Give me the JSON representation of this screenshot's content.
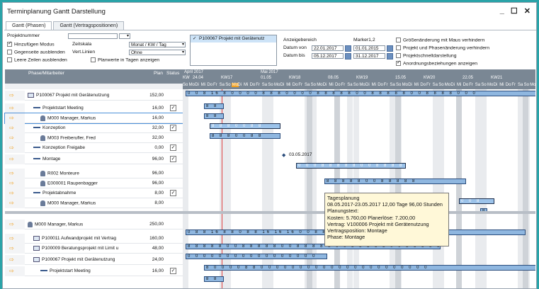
{
  "window": {
    "title": "Terminplanung Gantt Darstellung",
    "minimize": "_",
    "maximize": "☐",
    "close": "✕"
  },
  "tabs": [
    "Gantt (Phasen)",
    "Gantt (Vertragspositionen)"
  ],
  "params": {
    "projektnummer_label": "Projektnummer",
    "hinzufuegen_label": "Hinzufügen Modus",
    "gegenseite_label": "Gegenseite ausblenden",
    "leere_label": "Leere Zeilen ausblenden",
    "zeitskala_label": "Zeitskala",
    "zeitskala_value": "Monat / KW / Tag",
    "vertlinien_label": "Vert.Linien",
    "vertlinien_value": "Ohne",
    "planwerte_label": "Planwerte in Tagen  anzeigen",
    "anzeigebereich_label": "Anzeigebereich",
    "datum_von_label": "Datum von",
    "datum_von": "22.01.2017",
    "datum_bis_label": "Datum bis",
    "datum_bis": "05.12.2017",
    "marker_label": "Marker1,2",
    "marker1": "01.01.2015",
    "marker2": "31.12.2017",
    "opt1": "Größenänderung mit Maus verhindern",
    "opt2": "Projekt und Phasenänderung verhindern",
    "opt3": "Projektschnelldarstellung",
    "opt4": "Anordnungsbeziehungen anzeigen",
    "project_item": "P100067 Projekt mit Gerätenutz"
  },
  "table_header": {
    "phase": "Phase/Mitarbeiter",
    "plan": "Plan",
    "status": "Status"
  },
  "gantt_header": {
    "month1": "April 2017",
    "month2": "Mai 2017",
    "kw": [
      "KW",
      "24.04",
      "KW17",
      "01.05",
      "KW18",
      "08.05",
      "KW19",
      "15.05",
      "KW20",
      "22.05",
      "KW21"
    ],
    "days": [
      "So",
      "Mo",
      "Di",
      "Mi",
      "Do",
      "Fr",
      "Sa",
      "So",
      "Mo",
      "Di",
      "Mi",
      "Do",
      "Fr",
      "Sa",
      "So",
      "Mo",
      "Di",
      "Mi",
      "Do",
      "Fr",
      "Sa",
      "So",
      "Mo",
      "Di",
      "Mi",
      "Do",
      "Fr",
      "Sa",
      "So",
      "Mo",
      "Di",
      "Mi",
      "Do",
      "Fr",
      "Sa",
      "So",
      "Mo",
      "Di",
      "Mi",
      "Do",
      "Fr",
      "Sa",
      "So",
      "Mo",
      "Di",
      "Mi",
      "Do",
      "Fr",
      "Sa",
      "So",
      "Mo",
      "Di",
      "Mi",
      "Do",
      "Fr",
      "Sa",
      "So",
      "Mo"
    ]
  },
  "rows": [
    {
      "name": "P100067  Projekt mit Gerätenutzung",
      "plan": "152,00",
      "status": ""
    },
    {
      "name": "Projektstart Meeting",
      "plan": "16,00",
      "status": "✓"
    },
    {
      "name": "M000 Manager, Markus",
      "plan": "16,00",
      "status": ""
    },
    {
      "name": "Konzeption",
      "plan": "32,00",
      "status": "✓"
    },
    {
      "name": "M003 Freiberufler, Fred",
      "plan": "32,00",
      "status": ""
    },
    {
      "name": "Konzeption Freigabe",
      "plan": "0,00",
      "status": "✓"
    },
    {
      "name": "Montage",
      "plan": "96,00",
      "status": "✓"
    },
    {
      "name": "R002 Monteure",
      "plan": "96,00",
      "status": ""
    },
    {
      "name": "E000001 Raupenbagger",
      "plan": "96,00",
      "status": ""
    },
    {
      "name": "Projektabnahme",
      "plan": "8,00",
      "status": "✓"
    },
    {
      "name": "M000 Manager, Markus",
      "plan": "8,00",
      "status": ""
    },
    {
      "name": "M000 Manager, Markus",
      "plan": "250,00",
      "status": ""
    },
    {
      "name": "P100011  Aufwandprojekt mit Vertrag",
      "plan": "160,00",
      "status": ""
    },
    {
      "name": "P100009  Beratungsprojekt mit Limit u",
      "plan": "48,00",
      "status": ""
    },
    {
      "name": "P100067  Projekt mit Gerätenutzung",
      "plan": "24,00",
      "status": ""
    },
    {
      "name": "Projektstart Meeting",
      "plan": "16,00",
      "status": "✓"
    }
  ],
  "milestone_label": "03.05.2017",
  "tooltip": {
    "line1": "Tagesplanung",
    "line2": "08.05.2017-23.05.2017 12,00 Tage 96,00 Stunden",
    "line3": "Planungstext:",
    "line4": "Kosten: 5.760,00 Planerlöse: 7.200,00",
    "line5": "Vertrag: V100006 Projekt mit Gerätenutzung",
    "line6": "Vertragsposition: Montage",
    "line7": "Phase: Montage"
  },
  "bar_values": {
    "r0": "0 0 8 16 8 0 0 0 0 8 8 8 0 0 0 0 8 8 8 8 8 0 0 8 8 8 8 8 0 0 8 8 8 8 0 0 0",
    "r1": "8 8",
    "r2": "8 8",
    "r3": "8 8 8 0 0 8 8",
    "r4": "8 8 8 0 0 8 8",
    "r6": "0 0 0 8 8 8 8 8 0 0 8 8 8 8 8 0 0 8 8",
    "r7": "8 8 8 8 8 0 0 8 8 8 8 8",
    "r9": "0 0 8",
    "r10": "8",
    "r11": "0 8 8 16 8 8 0 8 8 16 16 16 0 0 8 8 8 8 8 0 0 8 8",
    "r12": "8 8 8 8 8 0 0 8 8 8 8 8 0 0 8 8 8 8 8 0 0 8 8 8 8 8 0 0 8 8 8 8 8 0 0",
    "r13": "0 0 0 0 0 0 0 0 0 0 0 0 0 0 0 0 0",
    "r14": "8 0 0 0 0 8 8 0 0 0 0 0 0 0 0 0 0 0 0 0 0 0 0 0 0 0 0 0 0",
    "r15": "8 8"
  }
}
